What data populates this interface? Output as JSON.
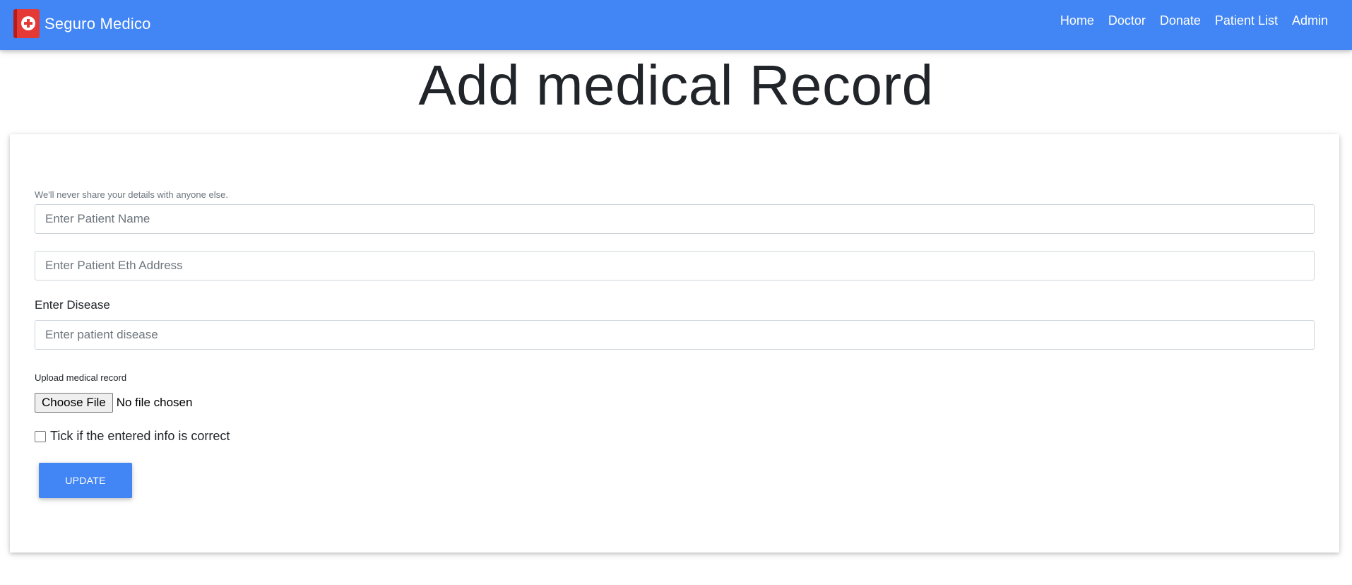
{
  "navbar": {
    "brand": "Seguro Medico",
    "logo_icon": "medical-cross-icon",
    "links": [
      {
        "label": "Home"
      },
      {
        "label": "Doctor"
      },
      {
        "label": "Donate"
      },
      {
        "label": "Patient List"
      },
      {
        "label": "Admin"
      }
    ],
    "background_color": "#4285f4"
  },
  "page": {
    "title": "Add medical Record"
  },
  "form": {
    "help_text": "We'll never share your details with anyone else.",
    "patient_name": {
      "placeholder": "Enter Patient Name",
      "value": ""
    },
    "patient_eth_address": {
      "placeholder": "Enter Patient Eth Address",
      "value": ""
    },
    "disease": {
      "label": "Enter Disease",
      "placeholder": "Enter patient disease",
      "value": ""
    },
    "upload": {
      "label": "Upload medical record",
      "button_label": "Choose File",
      "status": "No file chosen"
    },
    "confirm": {
      "label": "Tick if the entered info is correct",
      "checked": false
    },
    "submit_label": "UPDATE",
    "accent_color": "#4285f4"
  }
}
